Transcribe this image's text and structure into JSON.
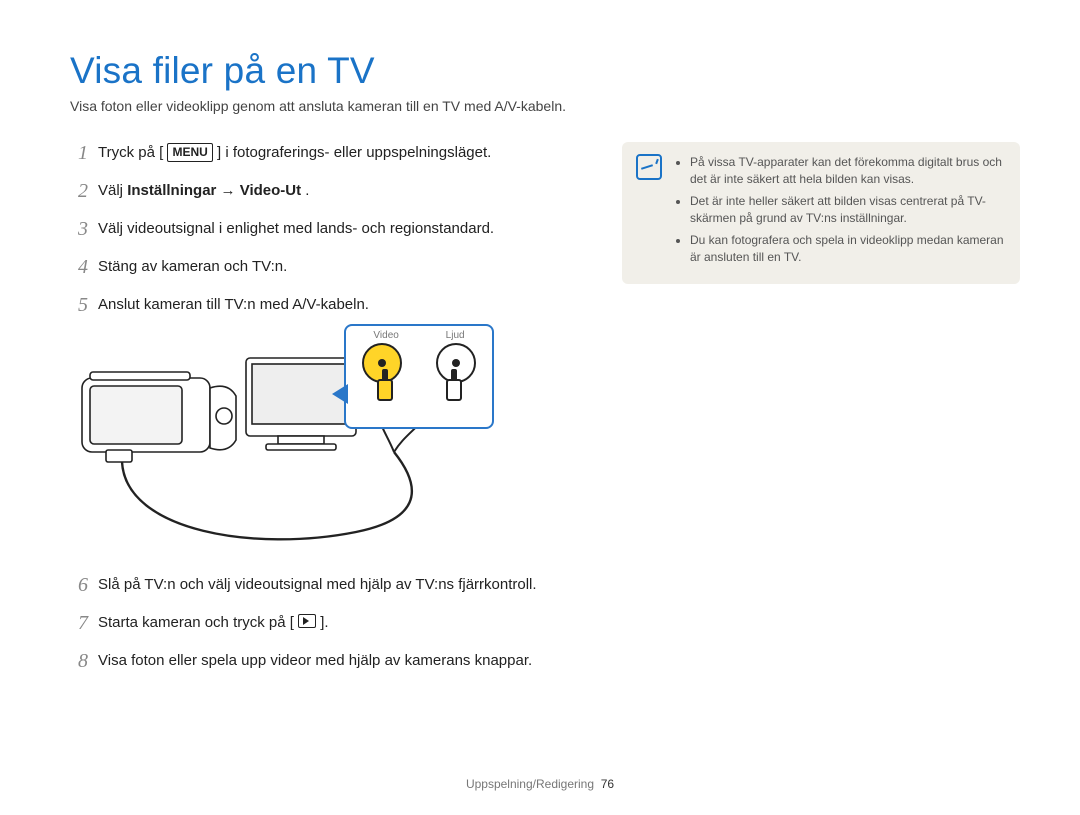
{
  "title": "Visa filer på en TV",
  "subtitle": "Visa foton eller videoklipp genom att ansluta kameran till en TV med A/V-kabeln.",
  "menu_chip": "MENU",
  "steps": {
    "s1a": "Tryck på [",
    "s1b": "] i fotograferings- eller uppspelningsläget.",
    "s2a": "Välj ",
    "s2b": "Inställningar",
    "s2c": " → ",
    "s2d": "Video-Ut",
    "s2e": ".",
    "s3": "Välj videoutsignal i enlighet med lands- och regionstandard.",
    "s4": "Stäng av kameran och TV:n.",
    "s5": "Anslut kameran till TV:n med A/V-kabeln.",
    "s6": "Slå på TV:n och välj videoutsignal med hjälp av TV:ns fjärrkontroll.",
    "s7a": "Starta kameran och tryck på [",
    "s7b": "].",
    "s8": "Visa foton eller spela upp videor med hjälp av kamerans knappar."
  },
  "step_numbers": {
    "n1": "1",
    "n2": "2",
    "n3": "3",
    "n4": "4",
    "n5": "5",
    "n6": "6",
    "n7": "7",
    "n8": "8"
  },
  "diagram": {
    "video_label": "Video",
    "audio_label": "Ljud"
  },
  "notes": {
    "n1": "På vissa TV-apparater kan det förekomma digitalt brus och det är inte säkert att hela bilden kan visas.",
    "n2": "Det är inte heller säkert att bilden visas centrerat på TV-skärmen på grund av TV:ns inställningar.",
    "n3": "Du kan fotografera och spela in videoklipp medan kameran är ansluten till en TV."
  },
  "footer": {
    "section": "Uppspelning/Redigering",
    "page": "76"
  }
}
